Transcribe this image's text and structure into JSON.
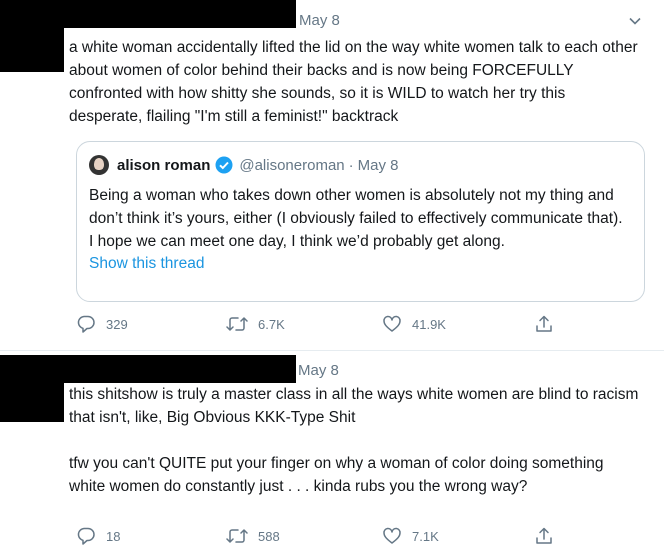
{
  "tweets": [
    {
      "date": "May 8",
      "text": "a white woman accidentally lifted the lid on the way white women talk to each other about women of color behind their backs and is now being FORCEFULLY confronted with how shitty she sounds, so it is WILD to watch her try this desperate, flailing \"I'm still a feminist!\" backtrack",
      "quote": {
        "name": "alison roman",
        "handle": "@alisoneroman",
        "separator": "·",
        "date": "May 8",
        "text": "Being a woman who takes down other women is absolutely not my thing and don’t think it’s yours, either (I obviously failed to effectively communicate that). I hope we can meet one day, I think we’d probably get along.",
        "show_thread": "Show this thread"
      },
      "replies": "329",
      "retweets": "6.7K",
      "likes": "41.9K"
    },
    {
      "date": "May 8",
      "text": "this shitshow is truly a master class in all the ways white women are blind to racism that isn't, like, Big Obvious KKK-Type Shit\n\ntfw you can't QUITE put your finger on why a woman of color doing something white women do constantly just . . . kinda rubs you the wrong way?",
      "replies": "18",
      "retweets": "588",
      "likes": "7.1K"
    }
  ],
  "icons": {
    "more": "chevron-down-icon",
    "reply": "reply-icon",
    "retweet": "retweet-icon",
    "like": "heart-icon",
    "share": "share-icon",
    "verified": "verified-badge-icon"
  },
  "colors": {
    "text": "#14171a",
    "muted": "#657786",
    "link": "#1b95e0",
    "verified": "#1da1f2",
    "border": "#ccd6dd",
    "redaction": "#000000"
  }
}
